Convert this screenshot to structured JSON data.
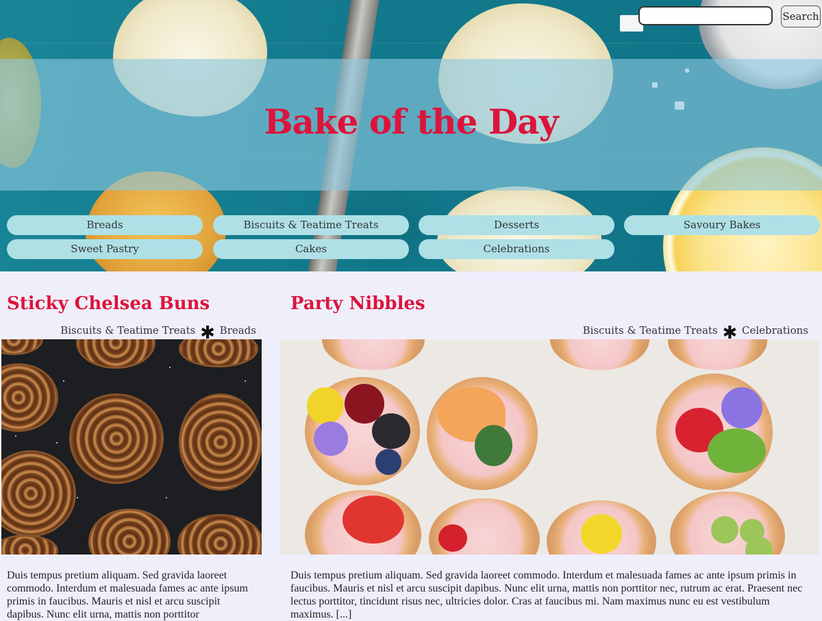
{
  "site": {
    "title": "Bake of the Day"
  },
  "search": {
    "placeholder": "",
    "value": "",
    "button_label": "Search"
  },
  "nav": {
    "items": [
      {
        "label": "Breads"
      },
      {
        "label": "Biscuits & Teatime Treats"
      },
      {
        "label": "Desserts"
      },
      {
        "label": "Savoury Bakes"
      },
      {
        "label": "Sweet Pastry"
      },
      {
        "label": "Cakes"
      },
      {
        "label": "Celebrations"
      }
    ]
  },
  "posts": [
    {
      "title": "Sticky Chelsea Buns",
      "tags": [
        "Biscuits & Teatime Treats",
        "Breads"
      ],
      "tag_separator": "✱",
      "image_subject": "chelsea-buns-photo",
      "excerpt": "Duis tempus pretium aliquam. Sed gravida laoreet commodo. Interdum et malesuada fames ac ante ipsum primis in faucibus. Mauris et nisl et arcu suscipit dapibus. Nunc elit urna, mattis non porttitor"
    },
    {
      "title": "Party Nibbles",
      "tags": [
        "Biscuits & Teatime Treats",
        "Celebrations"
      ],
      "tag_separator": "✱",
      "image_subject": "party-tarts-photo",
      "excerpt": "Duis tempus pretium aliquam. Sed gravida laoreet commodo. Interdum et malesuada fames ac ante ipsum primis in faucibus. Mauris et nisl et arcu suscipit dapibus. Nunc elit urna, mattis non porttitor nec, rutrum ac erat. Praesent nec lectus porttitor, tincidunt risus nec, ultricies dolor. Cras at faucibus mi. Nam maximus nunc eu est vestibulum maximus. [...]"
    }
  ],
  "colors": {
    "accent": "#dc143c",
    "nav_pill": "#aee0e6",
    "page_background": "#efeefb"
  }
}
